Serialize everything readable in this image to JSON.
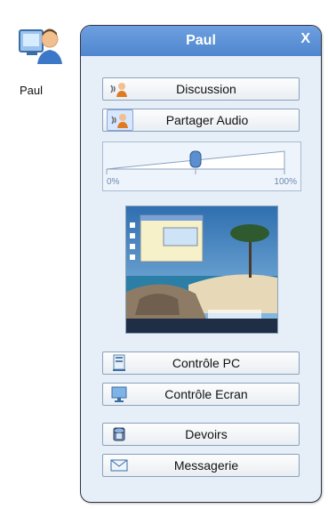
{
  "user": {
    "name": "Paul"
  },
  "panel": {
    "title": "Paul",
    "close_label": "X"
  },
  "actions": {
    "discussion": "Discussion",
    "share_audio": "Partager Audio",
    "control_pc": "Contrôle PC",
    "control_screen": "Contrôle Ecran",
    "homework": "Devoirs",
    "messaging": "Messagerie"
  },
  "volume": {
    "min_label": "0%",
    "max_label": "100%",
    "level_fraction": 0.5
  },
  "colors": {
    "title_bar": "#5f92d8",
    "panel_bg": "#e6eef8",
    "button_border": "#8aa2bc"
  },
  "icons": {
    "user_avatar": "user-avatar-icon",
    "discussion": "voice-chat-icon",
    "share_audio": "audio-share-icon",
    "control_pc": "pc-control-icon",
    "control_screen": "screen-control-icon",
    "homework": "homework-icon",
    "messaging": "mail-icon"
  }
}
